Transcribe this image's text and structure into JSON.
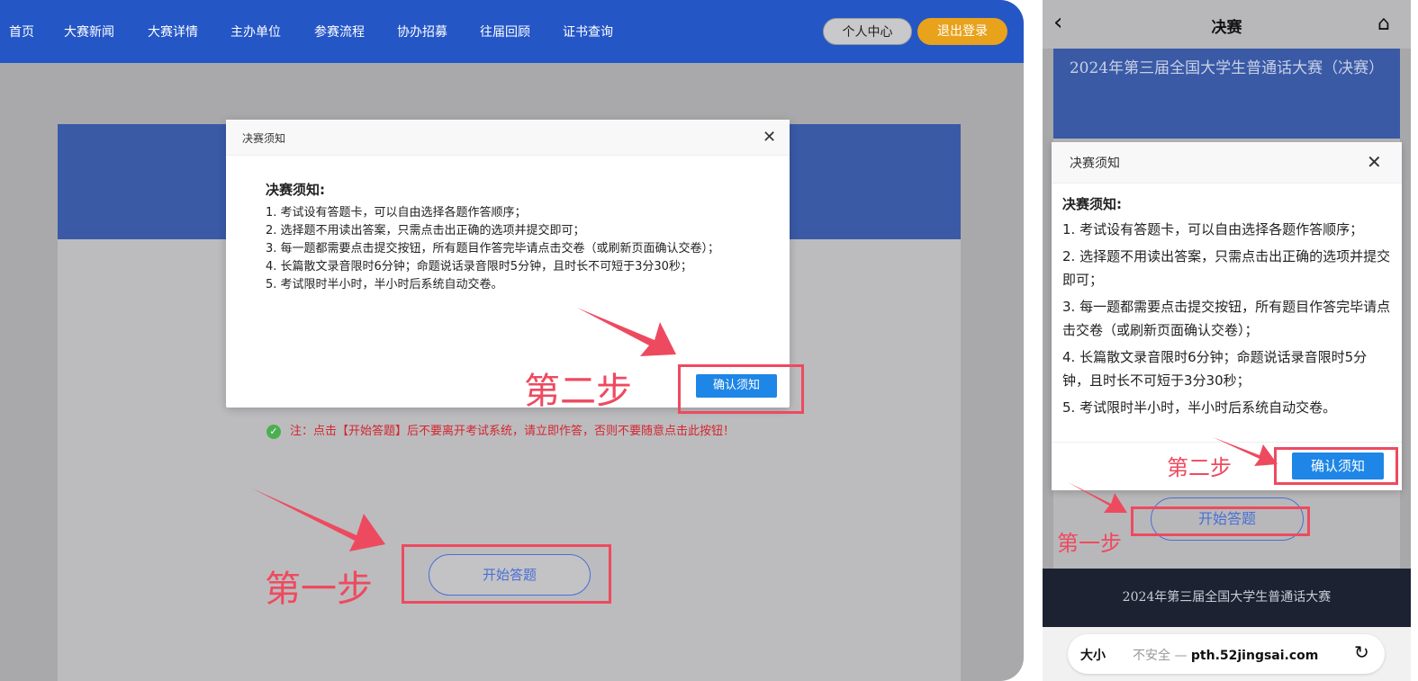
{
  "desktop": {
    "nav": {
      "items": [
        "首页",
        "大赛新闻",
        "大赛详情",
        "主办单位",
        "参赛流程",
        "协办招募",
        "往届回顾",
        "证书查询"
      ],
      "personal_center": "个人中心",
      "logout": "退出登录"
    },
    "notice": {
      "text": "注：点击【开始答题】后不要离开考试系统，请立即作答，否则不要随意点击此按钮！"
    },
    "start_button": "开始答题",
    "modal": {
      "title": "决赛须知",
      "heading": "决赛须知:",
      "rules": [
        "1. 考试设有答题卡，可以自由选择各题作答顺序；",
        "2. 选择题不用读出答案，只需点击出正确的选项并提交即可；",
        "3. 每一题都需要点击提交按钮，所有题目作答完毕请点击交卷（或刷新页面确认交卷）；",
        "4. 长篇散文录音限时6分钟；命题说话录音限时5分钟，且时长不可短于3分30秒；",
        "5. 考试限时半小时，半小时后系统自动交卷。"
      ],
      "confirm": "确认须知"
    },
    "annotations": {
      "step1": "第一步",
      "step2": "第二步"
    }
  },
  "mobile": {
    "page_title": "决赛",
    "banner_title": "2024年第三届全国大学生普通话大赛（决赛）",
    "start_button": "开始答题",
    "footer": "2024年第三届全国大学生普通话大赛",
    "modal": {
      "title": "决赛须知",
      "heading": "决赛须知:",
      "rules": [
        "1. 考试设有答题卡，可以自由选择各题作答顺序；",
        "2. 选择题不用读出答案，只需点击出正确的选项并提交即可；",
        "3. 每一题都需要点击提交按钮，所有题目作答完毕请点击交卷（或刷新页面确认交卷）；",
        "4. 长篇散文录音限时6分钟；命题说话录音限时5分钟，且时长不可短于3分30秒；",
        "5. 考试限时半小时，半小时后系统自动交卷。"
      ],
      "confirm": "确认须知"
    },
    "browser": {
      "text_size": "大小",
      "security": "不安全 —",
      "domain": "pth.52jingsai.com"
    },
    "annotations": {
      "step1": "第一步",
      "step2": "第二步"
    }
  },
  "colors": {
    "nav_blue": "#2456c6",
    "logout_orange": "#e8a21c",
    "confirm_blue": "#1e86e6",
    "annotation_red": "#ee4a5f",
    "notice_red": "#d4262f"
  }
}
